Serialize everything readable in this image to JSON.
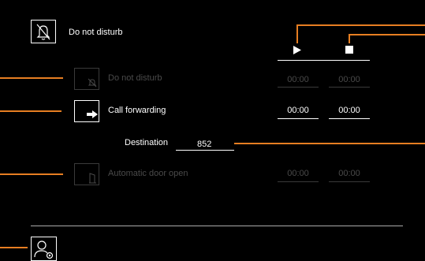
{
  "header": {
    "title": "Do not disturb",
    "icon": "bell-off-icon"
  },
  "columns": {
    "start_icon": "play-icon",
    "stop_icon": "stop-icon"
  },
  "rows": [
    {
      "label": "Do not disturb",
      "icon": "bell-off-icon",
      "start": "00:00",
      "end": "00:00",
      "enabled": false
    },
    {
      "label": "Call forwarding",
      "icon": "forward-arrow-icon",
      "start": "00:00",
      "end": "00:00",
      "enabled": true
    },
    {
      "label": "Automatic door open",
      "icon": "door-icon",
      "start": "00:00",
      "end": "00:00",
      "enabled": false
    }
  ],
  "destination": {
    "label": "Destination",
    "value": "852"
  },
  "footer": {
    "icon": "user-settings-icon"
  },
  "colors": {
    "background": "#000000",
    "text": "#ffffff",
    "disabled": "#4a4a4a",
    "callout": "#e67e22"
  }
}
